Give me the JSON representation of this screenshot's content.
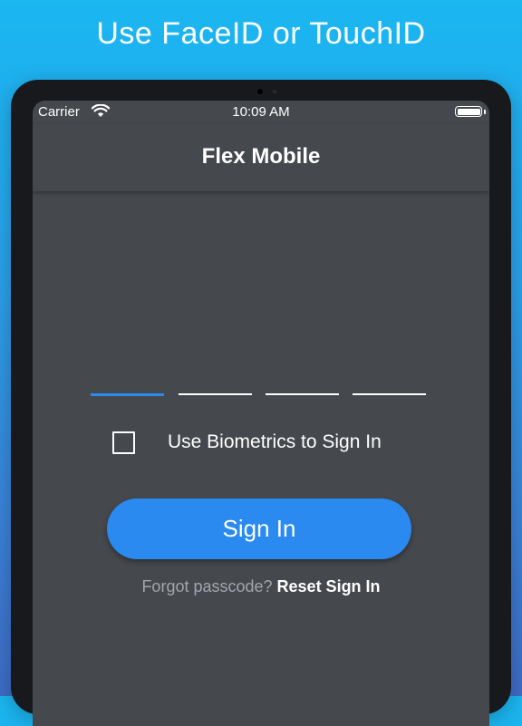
{
  "headline": "Use FaceID or TouchID",
  "status_bar": {
    "carrier": "Carrier",
    "time": "10:09 AM",
    "battery_level": 1.0
  },
  "nav": {
    "title": "Flex Mobile"
  },
  "pin": {
    "length": 4,
    "active_index": 0
  },
  "biometric": {
    "label": "Use Biometrics to Sign In",
    "checked": false
  },
  "sign_in_button": {
    "label": "Sign In"
  },
  "forgot": {
    "prompt": "Forgot passcode?",
    "link_label": "Reset Sign In"
  },
  "colors": {
    "background_top": "#1ab7f1",
    "background_bottom": "#3e6cc6",
    "screen_bg": "#45484d",
    "accent": "#2a8af0",
    "muted_text": "#a3a6ab"
  }
}
